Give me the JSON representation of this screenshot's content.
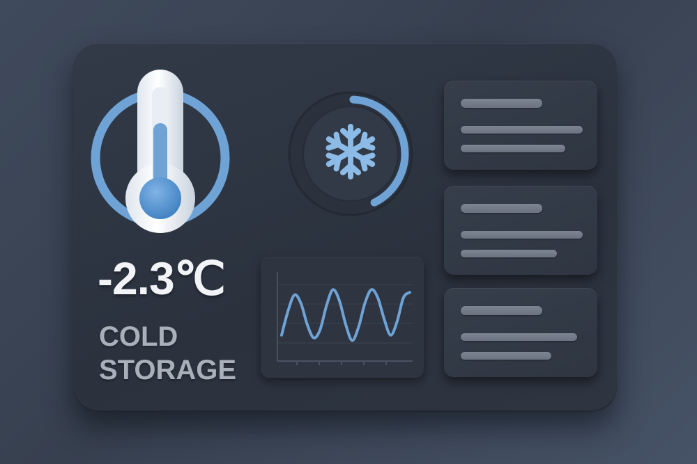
{
  "temperature": {
    "value": "-2.3℃"
  },
  "title": {
    "line1": "COLD",
    "line2": "STORAGE"
  },
  "gauge": {
    "level": 0.42,
    "icon": "snowflake-icon"
  },
  "colors": {
    "accent": "#6fa3d6",
    "accent_light": "#8bbbe6",
    "panel": "#2e3541",
    "text_primary": "#f1f3f6",
    "text_secondary": "#a9b0ba",
    "placeholder_bar": "#737b89"
  },
  "chart_data": {
    "type": "line",
    "title": "",
    "xlabel": "",
    "ylabel": "",
    "x": [
      0,
      1,
      2,
      3,
      4,
      5,
      6,
      7,
      8,
      9,
      10,
      11,
      12,
      13,
      14,
      15,
      16,
      17,
      18,
      19,
      20
    ],
    "values": [
      0.1,
      0.55,
      0.85,
      0.7,
      0.3,
      0.05,
      0.2,
      0.65,
      0.95,
      0.75,
      0.3,
      0.0,
      0.25,
      0.7,
      0.95,
      0.8,
      0.4,
      0.1,
      0.35,
      0.8,
      0.9
    ],
    "ylim": [
      -0.15,
      1.15
    ],
    "grid": true
  },
  "info_cards": [
    {
      "id": "card-1"
    },
    {
      "id": "card-2"
    },
    {
      "id": "card-3"
    }
  ]
}
